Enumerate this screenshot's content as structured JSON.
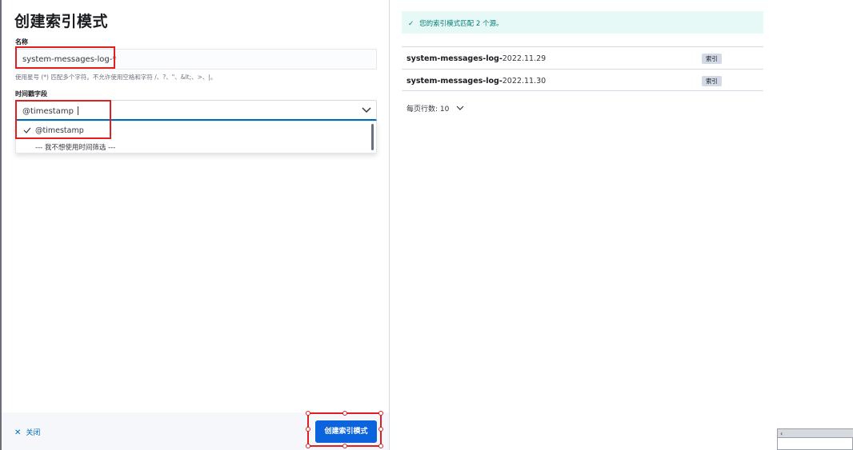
{
  "flyout": {
    "title": "创建索引模式",
    "name_label": "名称",
    "name_value": "system-messages-log-*",
    "name_help": "使用星号 (*) 匹配多个字符。不允许使用空格和字符 /、?、\"、&lt;、>、|。",
    "timestamp_label": "时间戳字段",
    "timestamp_value": "@timestamp",
    "timestamp_options": [
      "@timestamp",
      "--- 我不想使用时间筛选 ---"
    ],
    "close_label": "关闭",
    "create_label": "创建索引模式"
  },
  "preview": {
    "success_message": "您的索引模式匹配 2 个源。",
    "sources": [
      {
        "match": "system-messages-log-",
        "rest": "2022.11.29",
        "type": "索引"
      },
      {
        "match": "system-messages-log-",
        "rest": "2022.11.30",
        "type": "索引"
      }
    ],
    "rows_per_page_label": "每页行数: 10"
  },
  "icons": {
    "check": "check-icon",
    "chevron": "chevron-down-icon",
    "close": "close-icon",
    "scroll_left": "arrow-left-icon"
  },
  "colors": {
    "primary": "#0b64dd",
    "link": "#006bb8",
    "success_bg": "#e6f9f7",
    "success_text": "#017d73",
    "annotation": "#e02020"
  }
}
